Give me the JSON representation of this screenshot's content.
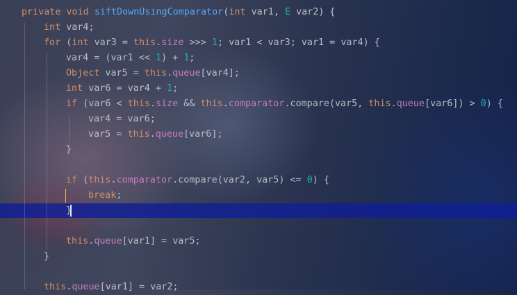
{
  "editor": {
    "lines": [
      "private void siftDownUsingComparator(int var1, E var2) {",
      "int var4;",
      "for (int var3 = this.size >>> 1; var1 < var3; var1 = var4) {",
      "var4 = (var1 << 1) + 1;",
      "Object var5 = this.queue[var4];",
      "int var6 = var4 + 1;",
      "if (var6 < this.size && this.comparator.compare(var5, this.queue[var6]) > 0) {",
      "var4 = var6;",
      "var5 = this.queue[var6];",
      "}",
      "",
      "if (this.comparator.compare(var2, var5) <= 0) {",
      "break;",
      "}",
      "",
      "this.queue[var1] = var5;",
      "}",
      "",
      "this.queue[var1] = var2;"
    ],
    "colors": {
      "keyword": "#cf8e6d",
      "field": "#c77dbb",
      "number": "#2aacb8",
      "method": "#56a8f5",
      "type_param": "#16baac",
      "text": "#bcbec4",
      "current_line": "#101e96"
    }
  }
}
